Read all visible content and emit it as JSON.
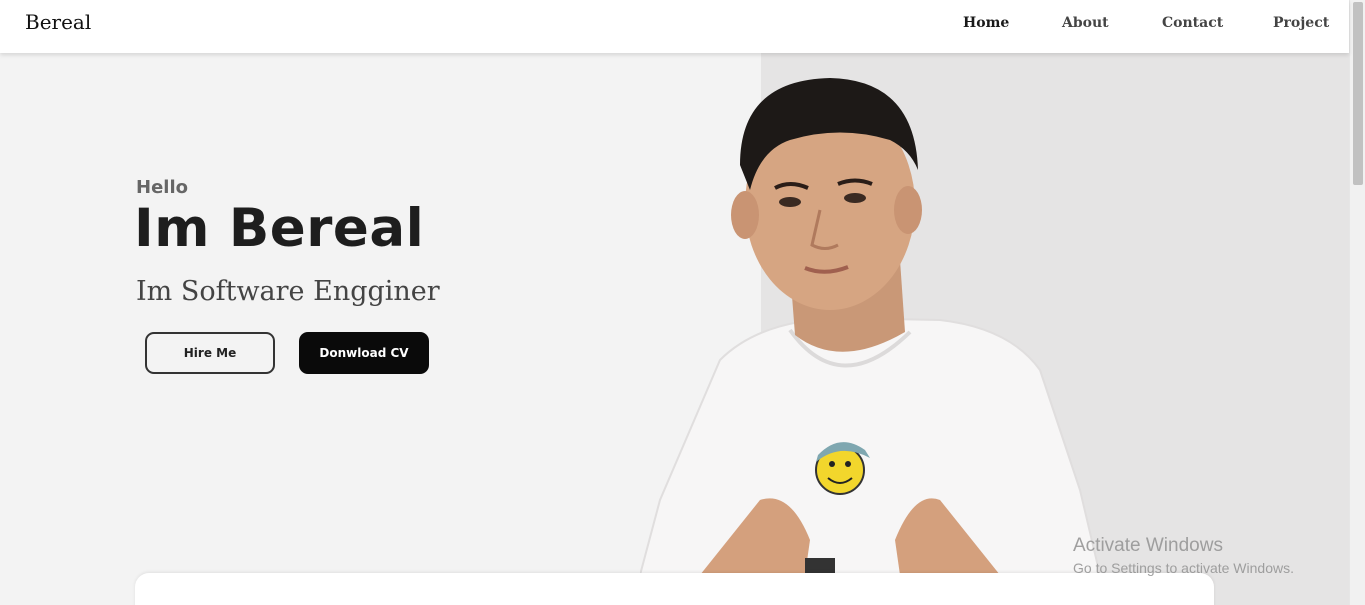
{
  "navbar": {
    "brand": "Bereal",
    "links": [
      "Home",
      "About",
      "Contact",
      "Project"
    ],
    "active_link": "Home"
  },
  "hero": {
    "greeting": "Hello",
    "title": "Im Bereal",
    "subtitle": "Im Software Engginer",
    "hire_button": "Hire Me",
    "download_button": "Donwload CV"
  },
  "watermark": {
    "title": "Activate Windows",
    "subtitle": "Go to Settings to activate Windows."
  },
  "colors": {
    "background": "#f3f3f3",
    "right_panel": "#e5e4e4",
    "primary_button": "#0a0a0a",
    "text_dark": "#1e1e1e"
  }
}
